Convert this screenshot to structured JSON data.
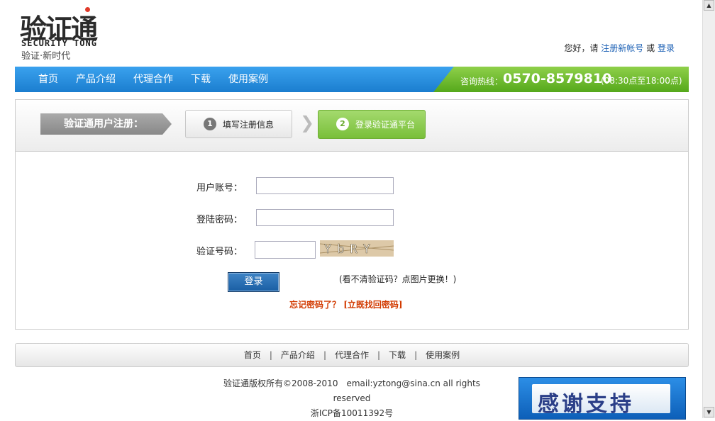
{
  "logo": {
    "main": "验证通",
    "english": "SECURITY TONG",
    "slogan": "验证·新时代"
  },
  "top": {
    "greeting": "您好，请",
    "register_link": "注册新帐号",
    "or": "或",
    "login_link": "登录"
  },
  "nav": {
    "items": [
      "首页",
      "产品介绍",
      "代理合作",
      "下载",
      "使用案例"
    ]
  },
  "hotline": {
    "label": "咨询热线：",
    "number": "0570-8579810",
    "hours": "(08:30点至18:00点)"
  },
  "steps": {
    "title": "验证通用户注册：",
    "step1": {
      "num": "1",
      "label": "填写注册信息"
    },
    "step2": {
      "num": "2",
      "label": "登录验证通平台"
    }
  },
  "form": {
    "account_label": "用户账号：",
    "account_value": "",
    "password_label": "登陆密码：",
    "password_value": "",
    "captcha_label": "验证号码：",
    "captcha_value": "",
    "captcha_image_text": "YbRY",
    "login_button": "登录",
    "captcha_hint": "(看不清验证码？点图片更换！)",
    "forgot_prefix": "忘记密码了？",
    "forgot_link": "[立既找回密码]"
  },
  "footer": {
    "nav": [
      "首页",
      "产品介绍",
      "代理合作",
      "下载",
      "使用案例"
    ],
    "copyright": "验证通版权所有©2008-2010　email:yztong@sina.cn  all rights reserved",
    "icp": "浙ICP备10011392号",
    "banner": "感谢支持"
  },
  "scrollbar": {
    "up_icon": "triangle-up-icon",
    "down_icon": "triangle-down-icon"
  }
}
